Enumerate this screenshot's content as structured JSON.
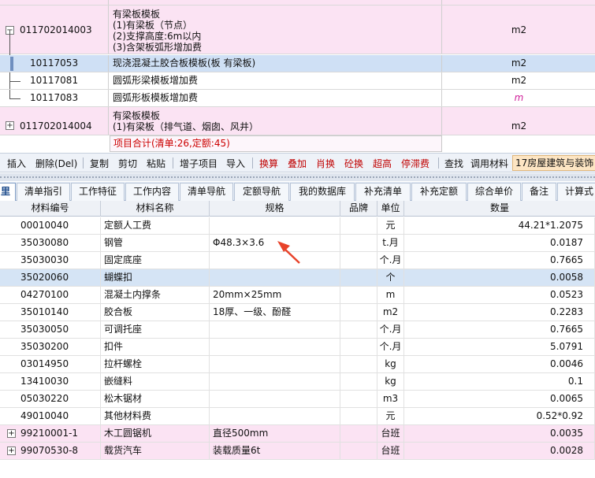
{
  "tree": {
    "rows": [
      {
        "code": "011702014003",
        "toggle": "−",
        "name": "有梁板模板\n(1)有梁板（节点）\n(2)支撑高度:6m以内\n(3)含架板弧形增加费",
        "unit": "m2"
      },
      {
        "code": "10117053",
        "name": "现浇混凝土胶合板模板(板 有梁板)",
        "unit": "m2"
      },
      {
        "code": "10117081",
        "name": "圆弧形梁模板增加费",
        "unit": "m2"
      },
      {
        "code": "10117083",
        "name": "圆弧形板模板增加费",
        "unit": "m"
      },
      {
        "code": "011702014004",
        "toggle": "+",
        "name": "有梁板模板\n(1)有梁板（排气道、烟囱、风井）",
        "unit": "m2"
      }
    ],
    "total_label": "项目合计(清单:26,定额:45)"
  },
  "toolbar": {
    "items": [
      "插入",
      "删除(Del)",
      "复制",
      "剪切",
      "粘贴",
      "增子项目",
      "导入",
      "换算",
      "叠加",
      "肖换",
      "砼换",
      "超高",
      "停滞费",
      "查找",
      "调用材料"
    ],
    "tab_label": "17房屋建筑与装饰",
    "accent_color": "#c00000"
  },
  "tabs": [
    "里",
    "清单指引",
    "工作特征",
    "工作内容",
    "清单导航",
    "定额导航",
    "我的数据库",
    "补充清单",
    "补充定额",
    "综合单价",
    "备注",
    "计算式"
  ],
  "grid": {
    "columns": [
      "材料编号",
      "材料名称",
      "规格",
      "品牌",
      "单位",
      "数量"
    ],
    "rows": [
      {
        "code": "00010040",
        "name": "定额人工费",
        "spec": "",
        "brand": "",
        "unit": "元",
        "qty": "44.21*1.2075"
      },
      {
        "code": "35030080",
        "name": "钢管",
        "spec": "Φ48.3×3.6",
        "brand": "",
        "unit": "t.月",
        "qty": "0.0187"
      },
      {
        "code": "35030030",
        "name": "固定底座",
        "spec": "",
        "brand": "",
        "unit": "个.月",
        "qty": "0.7665"
      },
      {
        "code": "35020060",
        "name": "蝴蝶扣",
        "spec": "",
        "brand": "",
        "unit": "个",
        "qty": "0.0058"
      },
      {
        "code": "04270100",
        "name": "混凝土内撑条",
        "spec": "20mm×25mm",
        "brand": "",
        "unit": "m",
        "qty": "0.0523"
      },
      {
        "code": "35010140",
        "name": "胶合板",
        "spec": "18厚、一级、酚醛",
        "brand": "",
        "unit": "m2",
        "qty": "0.2283"
      },
      {
        "code": "35030050",
        "name": "可调托座",
        "spec": "",
        "brand": "",
        "unit": "个.月",
        "qty": "0.7665"
      },
      {
        "code": "35030200",
        "name": "扣件",
        "spec": "",
        "brand": "",
        "unit": "个.月",
        "qty": "5.0791"
      },
      {
        "code": "03014950",
        "name": "拉杆螺栓",
        "spec": "",
        "brand": "",
        "unit": "kg",
        "qty": "0.0046"
      },
      {
        "code": "13410030",
        "name": "嵌缝料",
        "spec": "",
        "brand": "",
        "unit": "kg",
        "qty": "0.1"
      },
      {
        "code": "05030220",
        "name": "松木锯材",
        "spec": "",
        "brand": "",
        "unit": "m3",
        "qty": "0.0065"
      },
      {
        "code": "49010040",
        "name": "其他材料费",
        "spec": "",
        "brand": "",
        "unit": "元",
        "qty": "0.52*0.92"
      },
      {
        "code": "99210001-1",
        "name": "木工圆锯机",
        "spec": "直径500mm",
        "brand": "",
        "unit": "台班",
        "qty": "0.0035",
        "toggle": "+"
      },
      {
        "code": "99070530-8",
        "name": "载货汽车",
        "spec": "装载质量6t",
        "brand": "",
        "unit": "台班",
        "qty": "0.0028",
        "toggle": "+"
      }
    ]
  },
  "colors": {
    "pink_row": "#fbe3f3",
    "selected_row": "#cfe0f5",
    "arrow": "#e8432a",
    "red_text": "#cc0000"
  }
}
